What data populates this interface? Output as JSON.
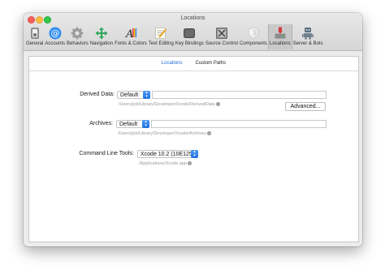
{
  "window": {
    "title": "Locations"
  },
  "toolbar": {
    "items": [
      {
        "label": "General",
        "icon": "general-switch-icon"
      },
      {
        "label": "Accounts",
        "icon": "at-sign-icon"
      },
      {
        "label": "Behaviors",
        "icon": "gear-icon"
      },
      {
        "label": "Navigation",
        "icon": "navigation-arrows-icon"
      },
      {
        "label": "Fonts & Colors",
        "icon": "fonts-colors-icon"
      },
      {
        "label": "Text Editing",
        "icon": "text-editing-icon"
      },
      {
        "label": "Key Bindings",
        "icon": "keyboard-icon"
      },
      {
        "label": "Source Control",
        "icon": "source-control-icon"
      },
      {
        "label": "Components",
        "icon": "shield-icon"
      },
      {
        "label": "Locations",
        "icon": "hard-drive-icon",
        "selected": true
      },
      {
        "label": "Server & Bots",
        "icon": "robot-icon"
      }
    ]
  },
  "tabs": [
    {
      "label": "Locations",
      "active": true
    },
    {
      "label": "Custom Paths",
      "active": false
    }
  ],
  "derived_data": {
    "label": "Derived Data:",
    "value": "Default",
    "path": "/Users/jcb/Library/Developer/Xcode/DerivedData",
    "advanced_label": "Advanced..."
  },
  "archives": {
    "label": "Archives:",
    "value": "Default",
    "path": "/Users/jcb/Library/Developer/Xcode/Archives"
  },
  "command_line_tools": {
    "label": "Command Line Tools:",
    "value": "Xcode 10.2 (10E125)",
    "path": "/Applications/Xcode.app"
  },
  "colors": {
    "accent": "#1f6fe0",
    "active_tab": "#1c6cd9"
  }
}
